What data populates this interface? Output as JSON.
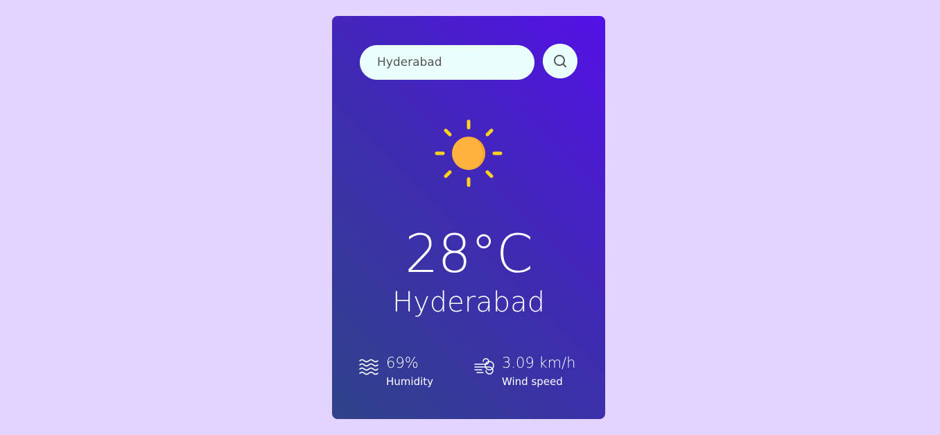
{
  "search": {
    "value": "Hyderabad",
    "icon": "search-icon"
  },
  "weather": {
    "icon": "sun-icon",
    "condition_icon_color": "#ffb23d",
    "ray_color": "#ffd21f",
    "temperature": "28°C",
    "city": "Hyderabad"
  },
  "details": {
    "humidity": {
      "icon": "humidity-waves-icon",
      "value": "69%",
      "label": "Humidity"
    },
    "wind": {
      "icon": "wind-icon",
      "value": "3.09 km/h",
      "label": "Wind speed"
    }
  },
  "colors": {
    "background": "#e3d3ff",
    "card_gradient_start": "#2f4389",
    "card_gradient_end": "#5310e6",
    "input_background": "#eafffb",
    "text": "#ffffff"
  }
}
